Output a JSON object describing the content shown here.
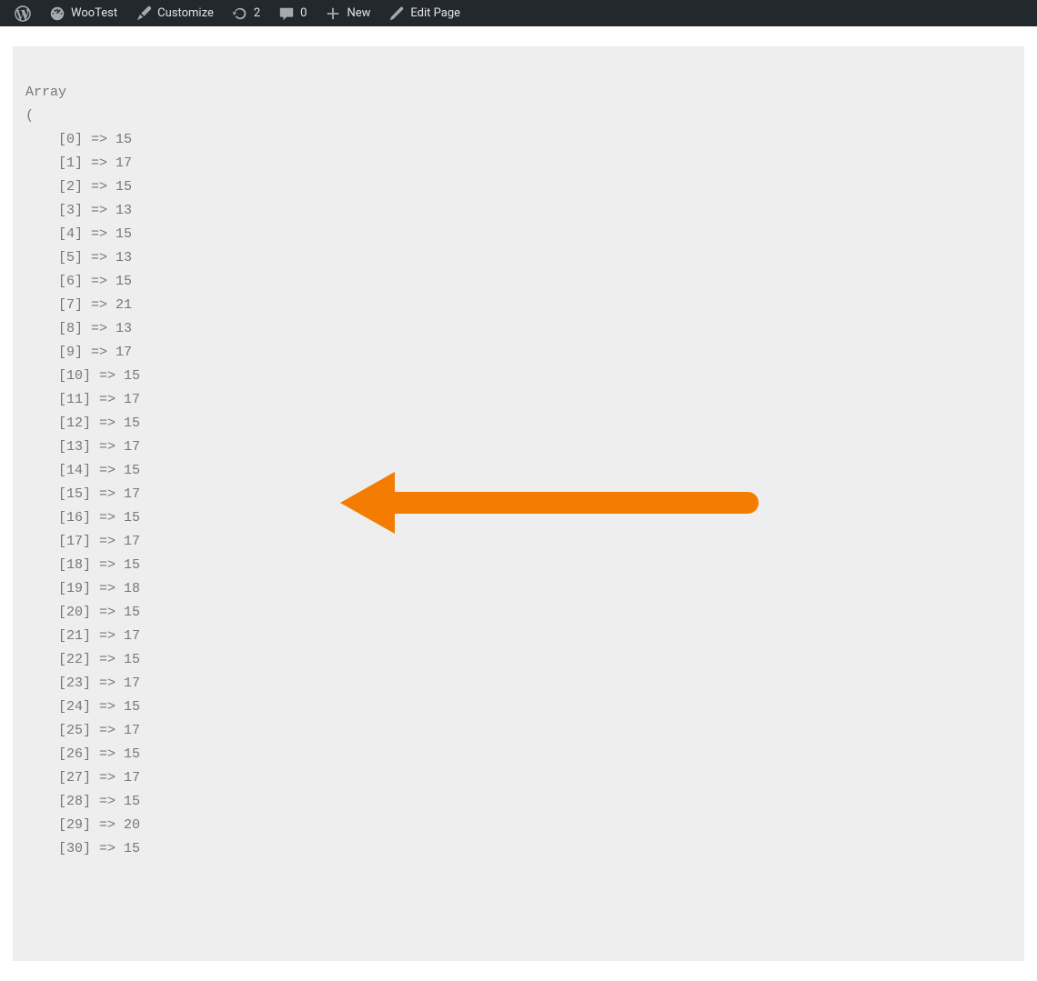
{
  "adminbar": {
    "site_name": "WooTest",
    "customize": "Customize",
    "updates": "2",
    "comments": "0",
    "new": "New",
    "edit": "Edit Page"
  },
  "pre": {
    "header": "Array",
    "open": "(",
    "rows": [
      {
        "idx": "0",
        "val": "15"
      },
      {
        "idx": "1",
        "val": "17"
      },
      {
        "idx": "2",
        "val": "15"
      },
      {
        "idx": "3",
        "val": "13"
      },
      {
        "idx": "4",
        "val": "15"
      },
      {
        "idx": "5",
        "val": "13"
      },
      {
        "idx": "6",
        "val": "15"
      },
      {
        "idx": "7",
        "val": "21"
      },
      {
        "idx": "8",
        "val": "13"
      },
      {
        "idx": "9",
        "val": "17"
      },
      {
        "idx": "10",
        "val": "15"
      },
      {
        "idx": "11",
        "val": "17"
      },
      {
        "idx": "12",
        "val": "15"
      },
      {
        "idx": "13",
        "val": "17"
      },
      {
        "idx": "14",
        "val": "15"
      },
      {
        "idx": "15",
        "val": "17"
      },
      {
        "idx": "16",
        "val": "15"
      },
      {
        "idx": "17",
        "val": "17"
      },
      {
        "idx": "18",
        "val": "15"
      },
      {
        "idx": "19",
        "val": "18"
      },
      {
        "idx": "20",
        "val": "15"
      },
      {
        "idx": "21",
        "val": "17"
      },
      {
        "idx": "22",
        "val": "15"
      },
      {
        "idx": "23",
        "val": "17"
      },
      {
        "idx": "24",
        "val": "15"
      },
      {
        "idx": "25",
        "val": "17"
      },
      {
        "idx": "26",
        "val": "15"
      },
      {
        "idx": "27",
        "val": "17"
      },
      {
        "idx": "28",
        "val": "15"
      },
      {
        "idx": "29",
        "val": "20"
      },
      {
        "idx": "30",
        "val": "15"
      }
    ]
  },
  "arrow_color": "#f47c00"
}
